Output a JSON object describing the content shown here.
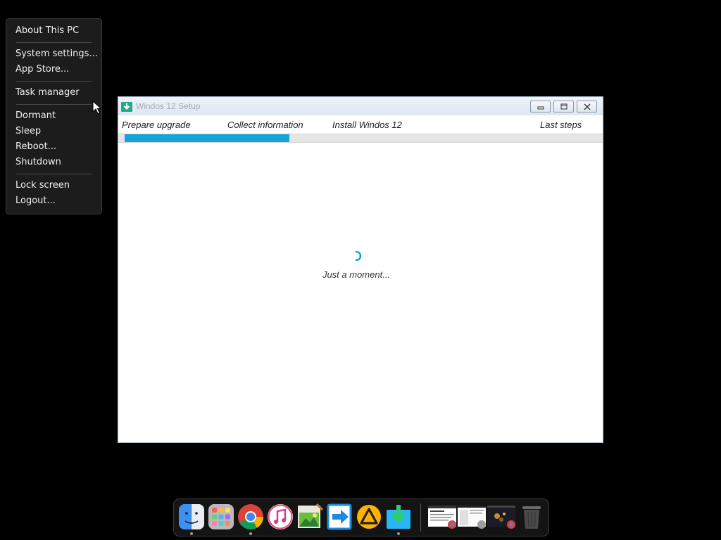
{
  "menu": {
    "items": [
      {
        "label": "About This PC"
      },
      {
        "label": "System settings..."
      },
      {
        "label": "App Store..."
      },
      {
        "label": "Task manager"
      },
      {
        "label": "Dormant"
      },
      {
        "label": "Sleep"
      },
      {
        "label": "Reboot..."
      },
      {
        "label": "Shutdown"
      },
      {
        "label": "Lock screen"
      },
      {
        "label": "Logout..."
      }
    ]
  },
  "setup_window": {
    "title": "Windos 12 Setup",
    "steps": [
      "Prepare upgrade",
      "Collect information",
      "Install Windos 12",
      "Last steps"
    ],
    "progress": 0.34,
    "status": "Just a moment..."
  },
  "dock": {
    "apps": [
      {
        "name": "finder-icon",
        "running": true
      },
      {
        "name": "launchpad-icon",
        "running": false
      },
      {
        "name": "chrome-icon",
        "running": true
      },
      {
        "name": "itunes-icon",
        "running": false
      },
      {
        "name": "image-editor-icon",
        "running": false
      },
      {
        "name": "migration-icon",
        "running": false
      },
      {
        "name": "aimp-icon",
        "running": false
      },
      {
        "name": "setup-icon",
        "running": true
      }
    ],
    "windows": [
      "chrome-window-thumbnail",
      "doc-window-thumbnail",
      "photo-window-thumbnail"
    ],
    "trash": "trash-icon"
  },
  "colors": {
    "accent": "#13a4d8",
    "background": "#000000",
    "menu_bg": "#1c1c1c"
  }
}
